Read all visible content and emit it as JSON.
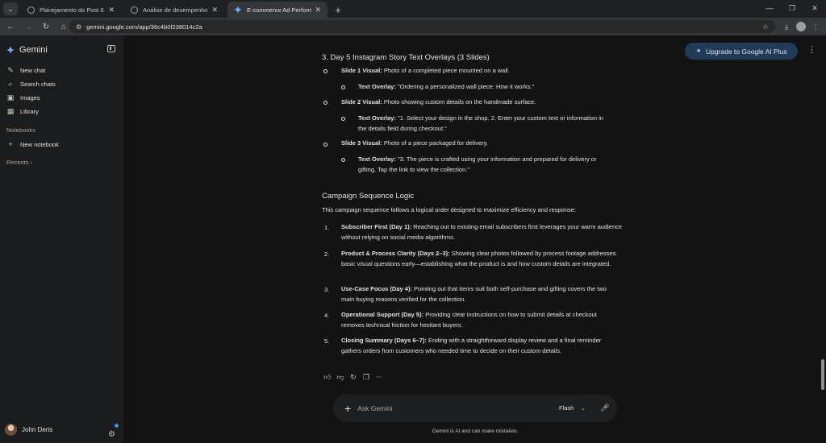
{
  "browser": {
    "tabs": [
      {
        "title": "Planejamento do Post 6",
        "active": false
      },
      {
        "title": "Análise de desempenho public",
        "active": false
      },
      {
        "title": "E-commerce Ad Performance A",
        "active": true
      }
    ],
    "url": "gemini.google.com/app/36c4b0f238014c2a"
  },
  "sidebar": {
    "brand": "Gemini",
    "items": [
      {
        "label": "New chat",
        "icon": "edit-icon"
      },
      {
        "label": "Search chats",
        "icon": "search-icon"
      },
      {
        "label": "Images",
        "icon": "image-icon"
      },
      {
        "label": "Library",
        "icon": "library-icon"
      }
    ],
    "notebooks_header": "Notebooks",
    "new_notebook": "New notebook",
    "recents": "Recents",
    "user_name": "John Deris"
  },
  "main": {
    "upgrade_label": "Upgrade to Google AI Plus",
    "section_heading": "3. Day 5 Instagram Story Text Overlays (3 Slides)",
    "slides": [
      {
        "visual_label": "Slide 1 Visual:",
        "visual_text": "Photo of a completed piece mounted on a wall.",
        "overlay_label": "Text Overlay:",
        "overlay_text": "\"Ordering a personalized wall piece: How it works.\""
      },
      {
        "visual_label": "Slide 2 Visual:",
        "visual_text": "Photo showing custom details on the handmade surface.",
        "overlay_label": "Text Overlay:",
        "overlay_text": "\"1. Select your design in the shop. 2. Enter your custom text or information in the details field during checkout.\""
      },
      {
        "visual_label": "Slide 3 Visual:",
        "visual_text": "Photo of a piece packaged for delivery.",
        "overlay_label": "Text Overlay:",
        "overlay_text": "\"3. The piece is crafted using your information and prepared for delivery or gifting. Tap the link to view the collection.\""
      }
    ],
    "logic_heading": "Campaign Sequence Logic",
    "logic_intro": "This campaign sequence follows a logical order designed to maximize efficiency and response:",
    "logic_items": [
      {
        "num": "1.",
        "label": "Subscriber First (Day 1):",
        "text": "Reaching out to existing email subscribers first leverages your warm audience without relying on social media algorithms."
      },
      {
        "num": "2.",
        "label": "Product & Process Clarity (Days 2–3):",
        "text": "Showing clear photos followed by process footage addresses basic visual questions early—establishing what the product is and how custom details are integrated."
      },
      {
        "num": "3.",
        "label": "Use-Case Focus (Day 4):",
        "text": "Pointing out that items suit both self-purchase and gifting covers the two main buying reasons verified for the collection."
      },
      {
        "num": "4.",
        "label": "Operational Support (Day 5):",
        "text": "Providing clear instructions on how to submit details at checkout removes technical friction for hesitant buyers."
      },
      {
        "num": "5.",
        "label": "Closing Summary (Days 6–7):",
        "text": "Ending with a straightforward display review and a final reminder gathers orders from customers who needed time to decide on their custom details."
      }
    ],
    "input_placeholder": "Ask Gemini",
    "model_label": "Flash",
    "disclaimer": "Gemini is AI and can make mistakes."
  },
  "colors": {
    "upgrade_bg": "#1f3b58",
    "main_bg": "#131314",
    "sidebar_bg": "#1b1c1d"
  }
}
